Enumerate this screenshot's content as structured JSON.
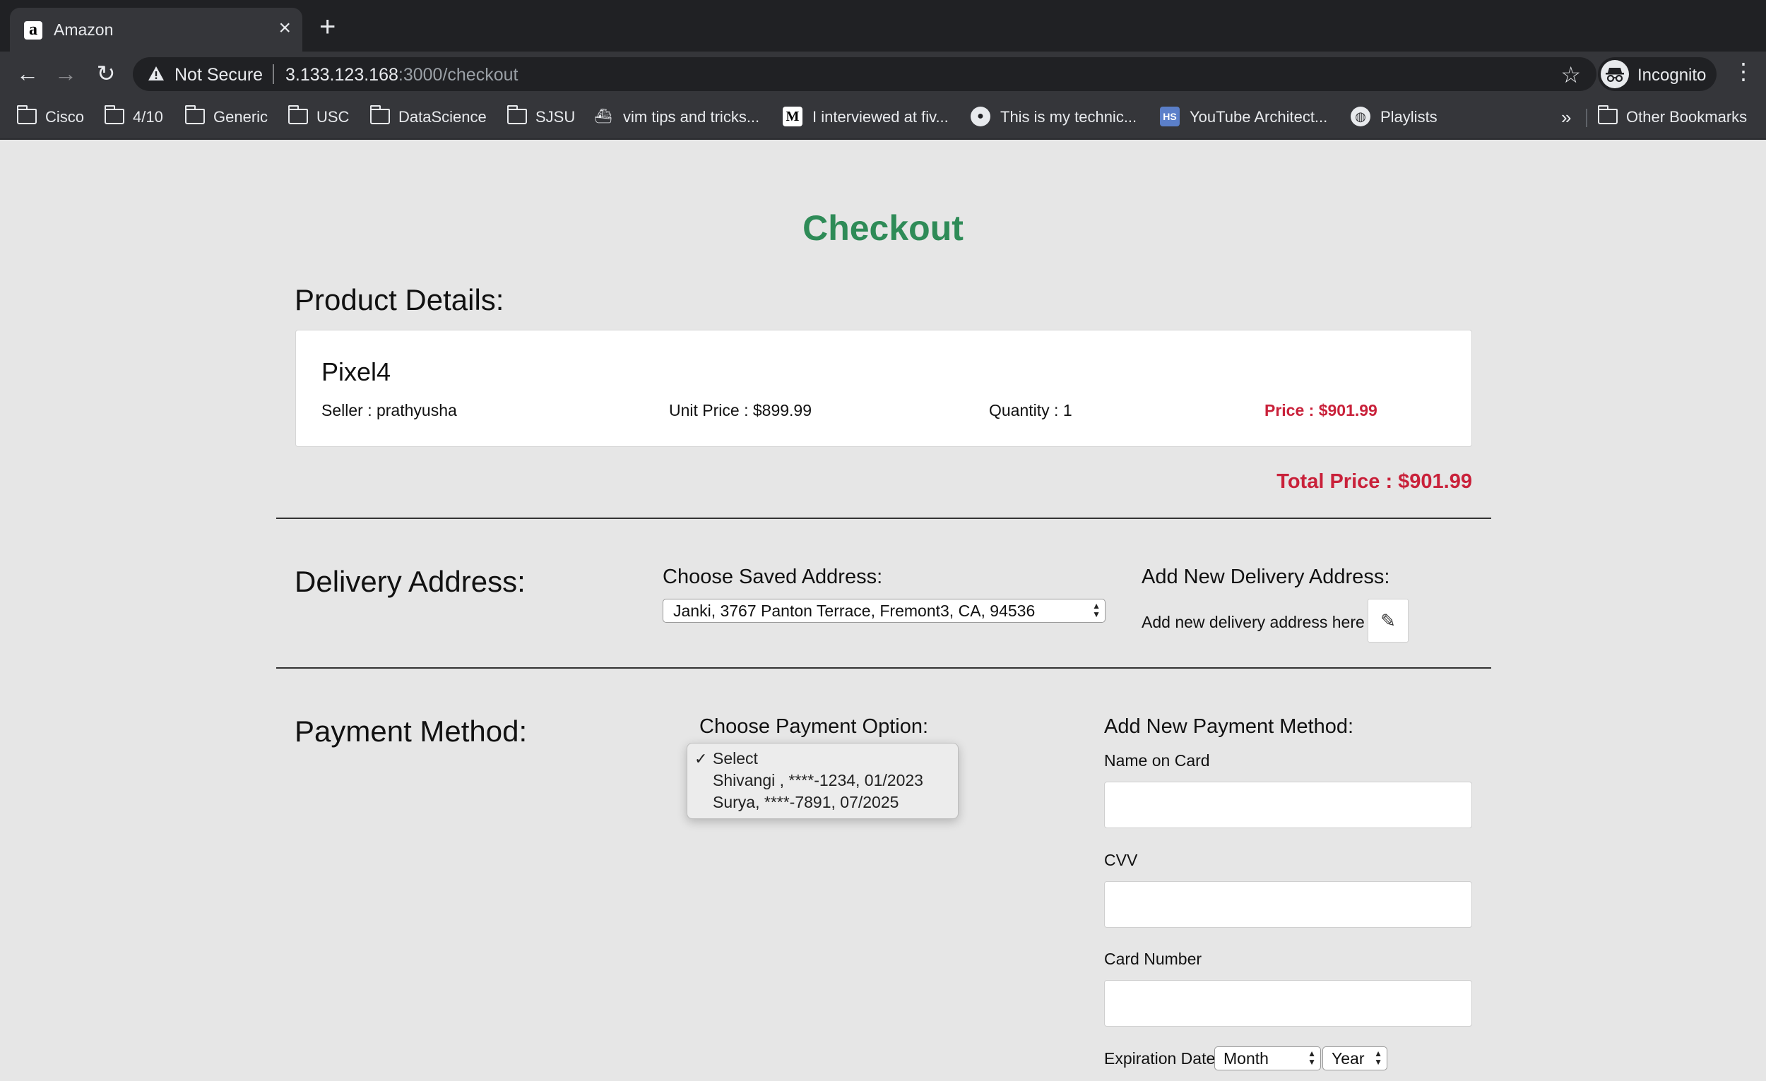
{
  "browser": {
    "tab_title": "Amazon",
    "security_label": "Not Secure",
    "url_host": "3.133.123.168",
    "url_path": ":3000/checkout",
    "profile_label": "Incognito",
    "bookmarks": [
      "Cisco",
      "4/10",
      "Generic",
      "USC",
      "DataScience",
      "SJSU",
      "vim tips and tricks...",
      "I interviewed at fiv...",
      "This is my technic...",
      "YouTube Architect...",
      "Playlists"
    ],
    "overflow_label": "»",
    "other_bookmarks": "Other Bookmarks"
  },
  "page": {
    "title": "Checkout",
    "product_section_title": "Product Details:",
    "product": {
      "name": "Pixel4",
      "seller": "Seller : prathyusha",
      "unit_price": "Unit Price : $899.99",
      "quantity": "Quantity : 1",
      "price": "Price : $901.99"
    },
    "total_price": "Total Price : $901.99",
    "delivery": {
      "section_title": "Delivery Address:",
      "saved_label": "Choose Saved Address:",
      "saved_value": "Janki, 3767 Panton Terrace, Fremont3, CA, 94536",
      "new_label": "Add New Delivery Address:",
      "new_hint": "Add new delivery address here"
    },
    "payment": {
      "section_title": "Payment Method:",
      "choose_label": "Choose Payment Option:",
      "options": [
        "Select",
        "Shivangi , ****-1234, 01/2023",
        "Surya, ****-7891, 07/2025"
      ],
      "new_label": "Add New Payment Method:",
      "name_label": "Name on Card",
      "cvv_label": "CVV",
      "card_number_label": "Card Number",
      "expiration_label": "Expiration Date",
      "month_value": "Month",
      "year_value": "Year"
    }
  },
  "colors": {
    "title_green": "#2e8b57",
    "price_red": "#c9213a",
    "page_bg": "#e6e6e6"
  },
  "icons": {
    "edit": "pencil-icon",
    "check": "checkmark-icon"
  }
}
